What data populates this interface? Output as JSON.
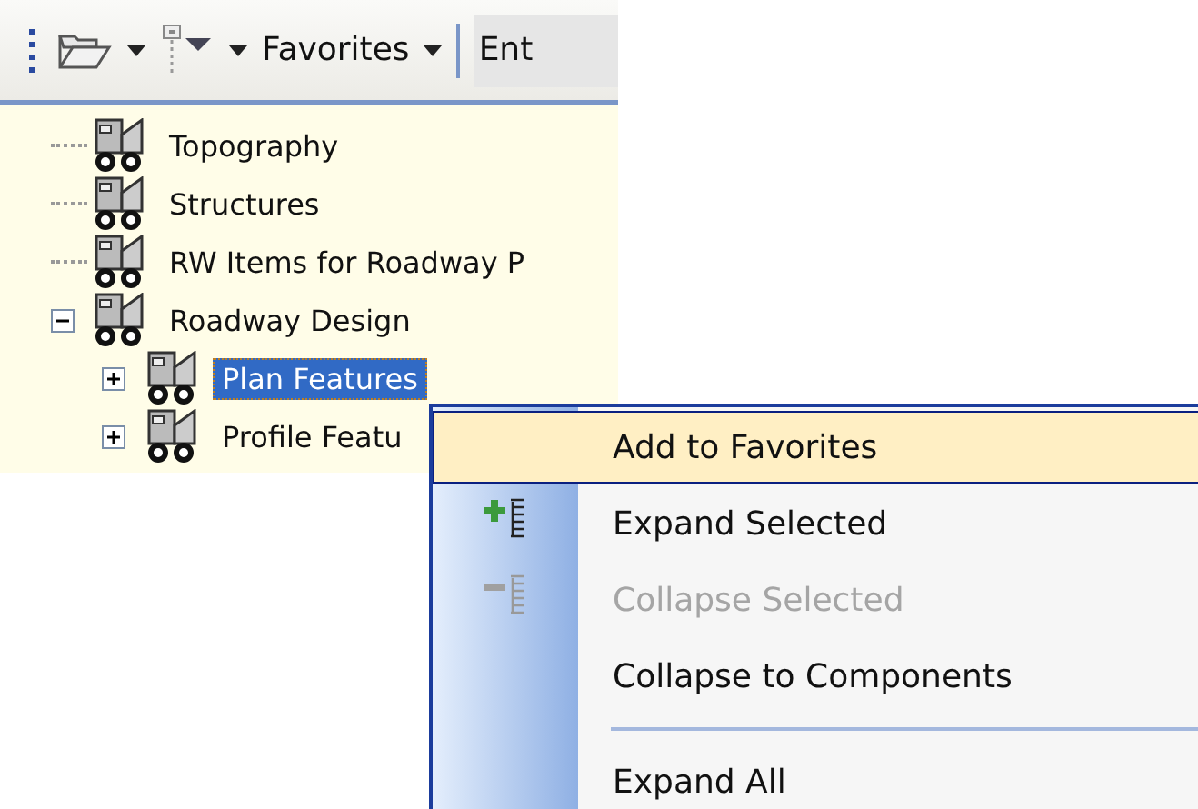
{
  "toolbar": {
    "items": [
      {
        "kind": "folder"
      },
      {
        "kind": "dropdown"
      },
      {
        "kind": "node"
      },
      {
        "kind": "dropdown"
      },
      {
        "kind": "label",
        "text": "Favorites"
      },
      {
        "kind": "dropdown"
      },
      {
        "kind": "separator"
      },
      {
        "kind": "field",
        "text": "Ent"
      }
    ]
  },
  "tree": [
    {
      "label": "Topography",
      "selected": false
    },
    {
      "label": "Structures",
      "selected": false
    },
    {
      "label": "RW Items for Roadway P",
      "selected": false
    },
    {
      "label": "Roadway Design",
      "expanded": true,
      "selected": false,
      "children": [
        {
          "label": "Plan Features",
          "expanded": false,
          "selected": true
        },
        {
          "label": "Profile Featu",
          "expanded": false,
          "selected": false
        }
      ]
    }
  ],
  "context_menu": [
    {
      "kind": "item",
      "label": "Add to Favorites",
      "selected": true,
      "disabled": false
    },
    {
      "kind": "expand",
      "label": "Expand Selected",
      "selected": false,
      "disabled": false
    },
    {
      "kind": "collapse",
      "label": "Collapse Selected",
      "selected": false,
      "disabled": true
    },
    {
      "kind": "item",
      "label": "Collapse to Components",
      "selected": false,
      "disabled": false
    },
    {
      "kind": "separator"
    },
    {
      "kind": "item",
      "label": "Expand All",
      "selected": false,
      "disabled": false
    }
  ]
}
